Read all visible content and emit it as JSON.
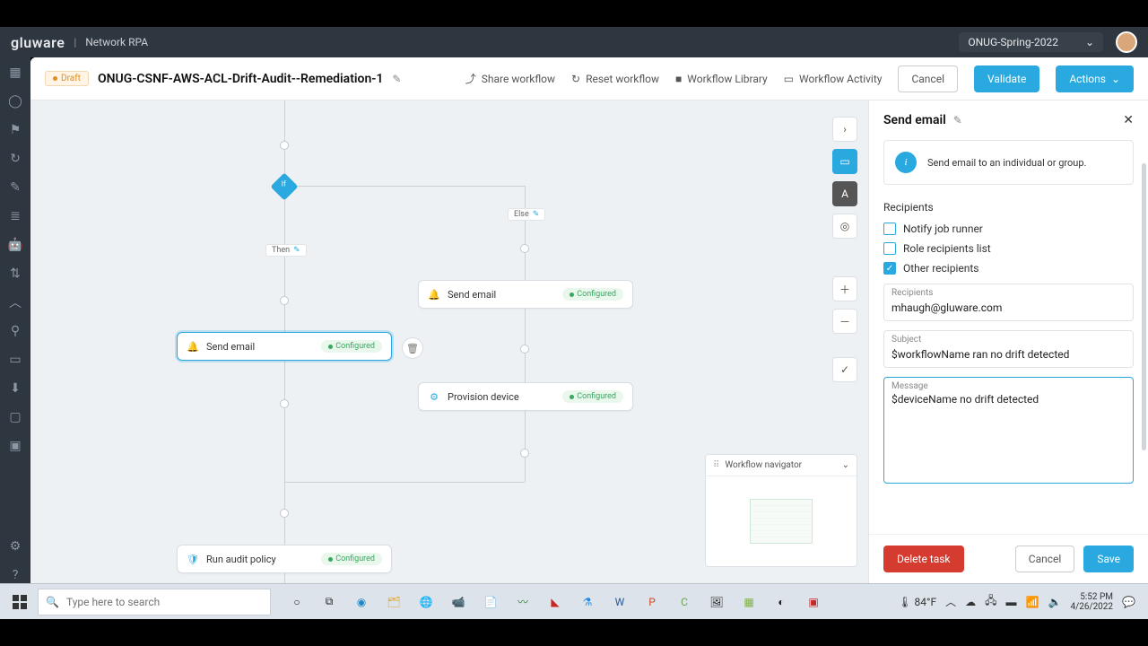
{
  "header": {
    "logo": "gluware",
    "subtitle": "Network RPA",
    "env": "ONUG-Spring-2022"
  },
  "toolbar": {
    "draft": "Draft",
    "title": "ONUG-CSNF-AWS-ACL-Drift-Audit--Remediation-1",
    "share": "Share workflow",
    "reset": "Reset workflow",
    "library": "Workflow Library",
    "activity": "Workflow Activity",
    "cancel": "Cancel",
    "validate": "Validate",
    "actions": "Actions"
  },
  "canvas": {
    "if": "If",
    "then": "Then",
    "else": "Else",
    "t_send_email": "Send email",
    "t_provision": "Provision device",
    "t_runaudit": "Run audit policy",
    "configured": "Configured",
    "navigator": "Workflow navigator"
  },
  "panel": {
    "title": "Send email",
    "info": "Send email to an individual or group.",
    "section_rec": "Recipients",
    "cb_notify": "Notify job runner",
    "cb_role": "Role recipients list",
    "cb_other": "Other recipients",
    "f_recipients_label": "Recipients",
    "f_recipients_value": "mhaugh@gluware.com",
    "f_subject_label": "Subject",
    "f_subject_value": "$workflowName ran no drift detected",
    "f_message_label": "Message",
    "f_message_value": "$deviceName no drift detected",
    "btn_delete": "Delete task",
    "btn_cancel": "Cancel",
    "btn_save": "Save"
  },
  "taskbar": {
    "search_ph": "Type here to search",
    "weather": "84°F",
    "time": "5:52 PM",
    "date": "4/26/2022"
  }
}
